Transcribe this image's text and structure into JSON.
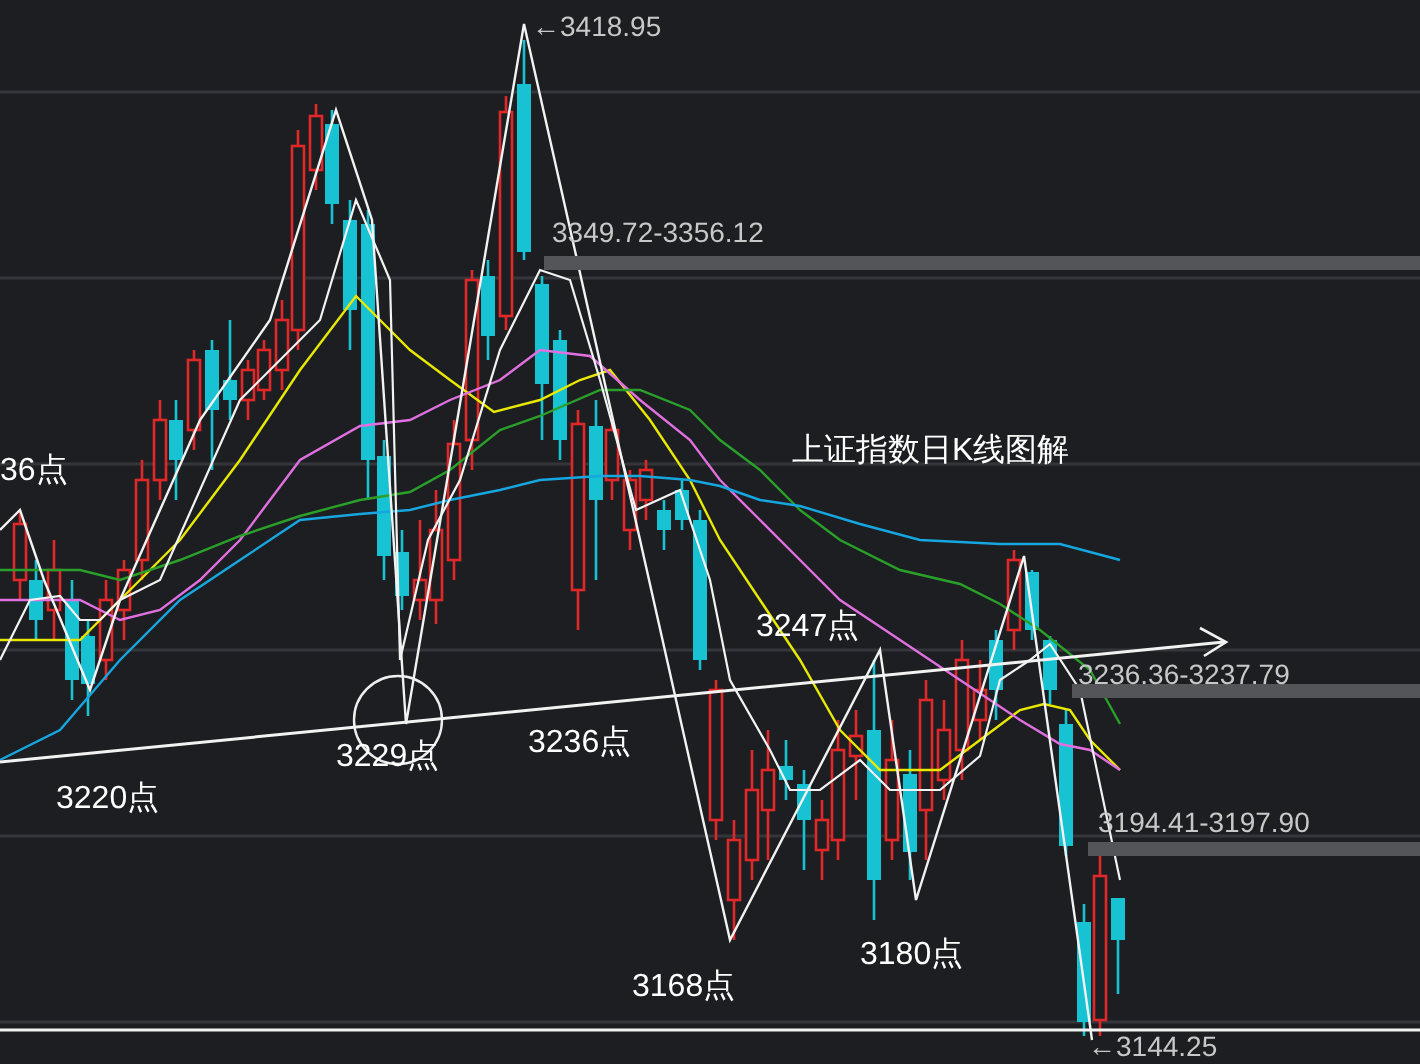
{
  "title": "上证指数日K线图解",
  "extremes": [
    {
      "kind": "high",
      "text": "←3418.95"
    },
    {
      "kind": "low",
      "text": "←3144.25"
    }
  ],
  "zones": [
    {
      "text": "3349.72-3356.12"
    },
    {
      "text": "3236.36-3237.79"
    },
    {
      "text": "3194.41-3197.90"
    }
  ],
  "points": [
    {
      "text": "36点"
    },
    {
      "text": "3220点"
    },
    {
      "text": "3229点"
    },
    {
      "text": "3236点"
    },
    {
      "text": "3247点"
    },
    {
      "text": "3168点"
    },
    {
      "text": "3180点"
    }
  ]
}
